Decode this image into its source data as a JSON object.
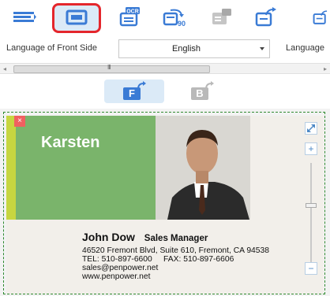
{
  "toolbar": {
    "buttons": [
      {
        "name": "scan-icon",
        "active": false
      },
      {
        "name": "card-frame-icon",
        "active": true
      },
      {
        "name": "ocr-icon",
        "active": false
      },
      {
        "name": "rotate-90-icon",
        "active": false
      },
      {
        "name": "export-card-icon",
        "active": false
      },
      {
        "name": "upload-icon",
        "active": false
      },
      {
        "name": "upload-more-icon",
        "active": false
      }
    ],
    "ocr_label": "OCR",
    "rotate_label": "90"
  },
  "language": {
    "front_label": "Language of Front Side",
    "front_value": "English",
    "back_label": "Language"
  },
  "scrollbar": {
    "grip": "III"
  },
  "sides": {
    "front_label": "F",
    "back_label": "B"
  },
  "card": {
    "banner_name": "Karsten",
    "name": "John Dow",
    "title": "Sales Manager",
    "address": "46520 Fremont Blvd, Suite 610, Fremont, CA 94538",
    "phone_fax": "TEL: 510-897-6600     FAX: 510-897-6606",
    "email": "sales@penpower.net",
    "website": "www.penpower.net"
  },
  "canvas": {
    "close_symbol": "×",
    "zoom_plus": "+",
    "zoom_minus": "−",
    "zoom_level": 0.5
  },
  "colors": {
    "accent": "#3a7bd5",
    "active_border": "#e4262c",
    "green": "#7ab46b"
  }
}
